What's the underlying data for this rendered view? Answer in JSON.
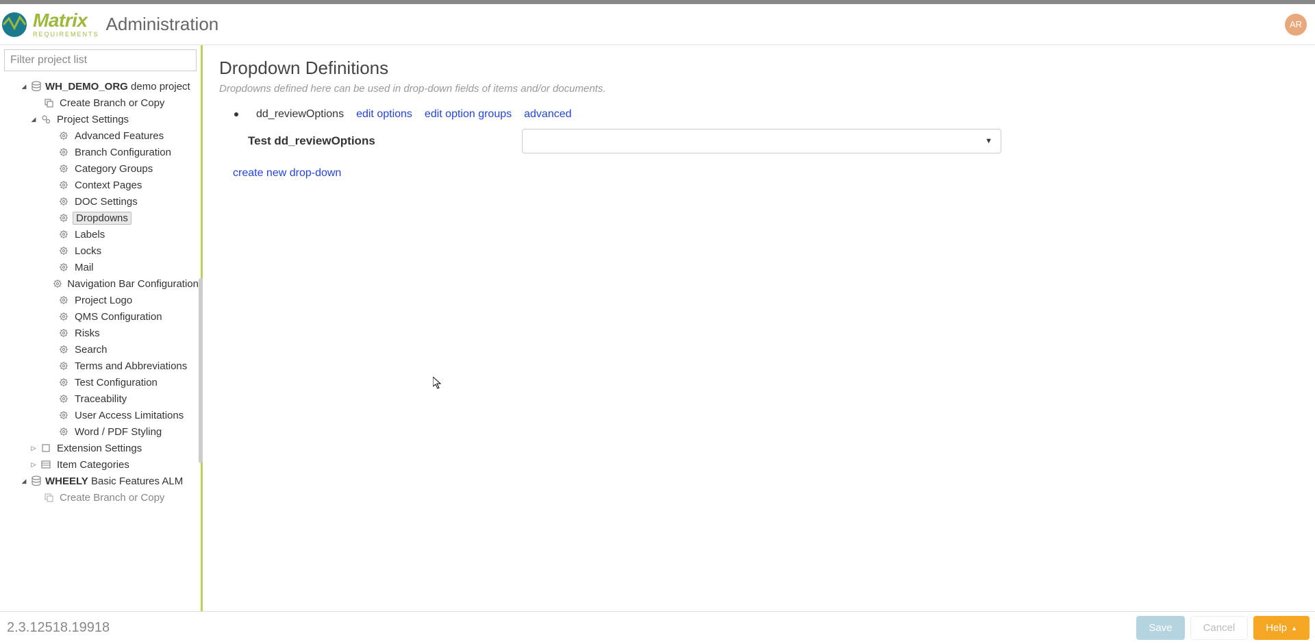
{
  "header": {
    "title": "Administration",
    "logo_main": "Matrix",
    "logo_sub": "REQUIREMENTS",
    "avatar_initials": "AR"
  },
  "sidebar": {
    "filter_placeholder": "Filter project list",
    "project1": {
      "name": "WH_DEMO_ORG",
      "desc": "demo project"
    },
    "create_branch": "Create Branch or Copy",
    "project_settings": "Project Settings",
    "settings": {
      "advanced_features": "Advanced Features",
      "branch_config": "Branch Configuration",
      "category_groups": "Category Groups",
      "context_pages": "Context Pages",
      "doc_settings": "DOC Settings",
      "dropdowns": "Dropdowns",
      "labels": "Labels",
      "locks": "Locks",
      "mail": "Mail",
      "nav_bar": "Navigation Bar Configuration",
      "project_logo": "Project Logo",
      "qms": "QMS Configuration",
      "risks": "Risks",
      "search": "Search",
      "terms": "Terms and Abbreviations",
      "test_config": "Test Configuration",
      "traceability": "Traceability",
      "user_access": "User Access Limitations",
      "word_pdf": "Word / PDF Styling"
    },
    "extension_settings": "Extension Settings",
    "item_categories": "Item Categories",
    "project2": {
      "name": "WHEELY",
      "desc": "Basic Features ALM"
    },
    "create_branch2": "Create Branch or Copy"
  },
  "main": {
    "title": "Dropdown Definitions",
    "description": "Dropdowns defined here can be used in drop-down fields of items and/or documents.",
    "dd_item_name": "dd_reviewOptions",
    "link_edit_options": "edit options",
    "link_edit_groups": "edit option groups",
    "link_advanced": "advanced",
    "test_label": "Test dd_reviewOptions",
    "create_link": "create new drop-down"
  },
  "footer": {
    "version": "2.3.12518.19918",
    "save": "Save",
    "cancel": "Cancel",
    "help": "Help"
  }
}
